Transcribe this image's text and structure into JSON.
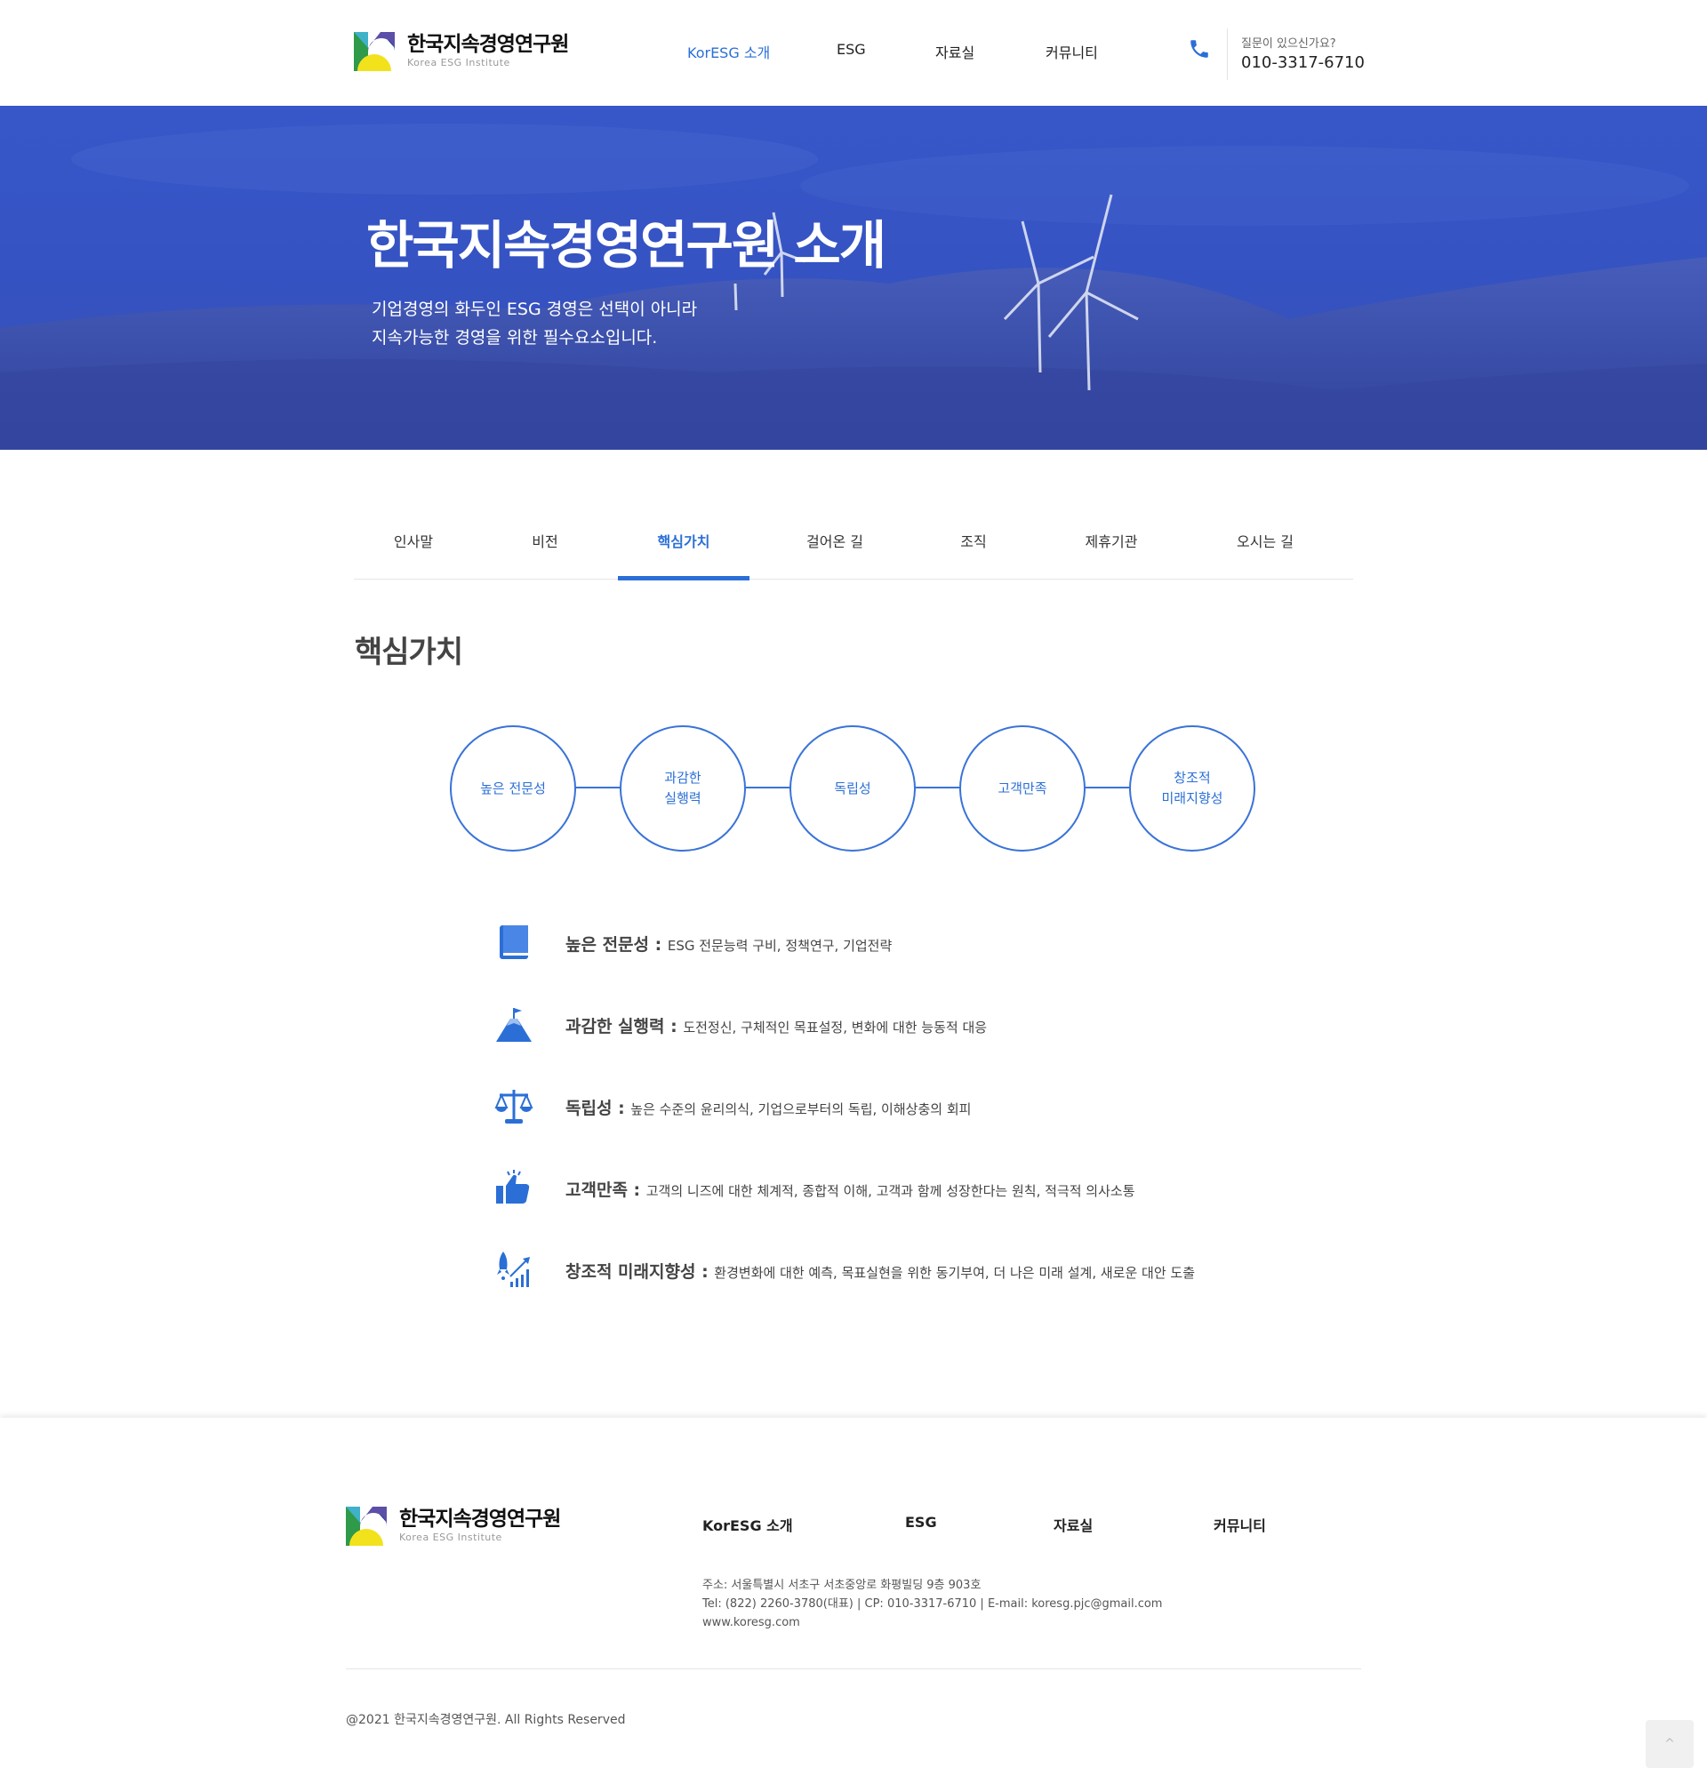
{
  "brand": {
    "name": "한국지속경영연구원",
    "sub": "Korea ESG Institute"
  },
  "nav": [
    {
      "label": "KorESG 소개",
      "active": true
    },
    {
      "label": "ESG",
      "active": false
    },
    {
      "label": "자료실",
      "active": false
    },
    {
      "label": "커뮤니티",
      "active": false
    }
  ],
  "contact": {
    "question": "질문이 있으신가요?",
    "phone": "010-3317-6710"
  },
  "hero": {
    "title": "한국지속경영연구원 소개",
    "line1": "기업경영의 화두인 ESG 경영은 선택이 아니라",
    "line2": "지속가능한 경영을 위한 필수요소입니다."
  },
  "tabs": [
    "인사말",
    "비전",
    "핵심가치",
    "걸어온 길",
    "조직",
    "제휴기관",
    "오시는 길"
  ],
  "active_tab": "핵심가치",
  "section_title": "핵심가치",
  "circles": [
    "높은 전문성",
    "과감한\n실행력",
    "독립성",
    "고객만족",
    "창조적\n미래지향성"
  ],
  "values": [
    {
      "icon": "book-icon",
      "name": "높은 전문성",
      "colon": " : ",
      "desc": "ESG 전문능력 구비, 정책연구, 기업전략"
    },
    {
      "icon": "mountain-flag-icon",
      "name": "과감한 실행력",
      "colon": " : ",
      "desc": "도전정신, 구체적인 목표설정, 변화에 대한 능동적 대응"
    },
    {
      "icon": "scale-icon",
      "name": "독립성",
      "colon": " : ",
      "desc": "높은 수준의 윤리의식, 기업으로부터의 독립, 이해상충의 회피"
    },
    {
      "icon": "thumbs-up-icon",
      "name": "고객만족",
      "colon": " : ",
      "desc": "고객의 니즈에 대한 체계적, 종합적 이해, 고객과 함께 성장한다는 원칙, 적극적 의사소통"
    },
    {
      "icon": "rocket-growth-icon",
      "name": "창조적 미래지향성",
      "colon": " : ",
      "desc": "환경변화에 대한 예측, 목표실현을 위한 동기부여, 더 나은 미래 설계, 새로운 대안 도출"
    }
  ],
  "footer": {
    "nav": [
      "KorESG 소개",
      "ESG",
      "자료실",
      "커뮤니티"
    ],
    "address": "주소: 서울특별시 서초구 서초중앙로 화평빌딩 9층 903호",
    "contact": "Tel: (822) 2260-3780(대표) | CP: 010-3317-6710 | E-mail: koresg.pjc@gmail.com",
    "website": "www.koresg.com",
    "copyright": "@2021 한국지속경영연구원. All Rights Reserved",
    "top_label": "^"
  },
  "colors": {
    "accent": "#2b6fd6",
    "hero_bg": "#3757c9"
  }
}
